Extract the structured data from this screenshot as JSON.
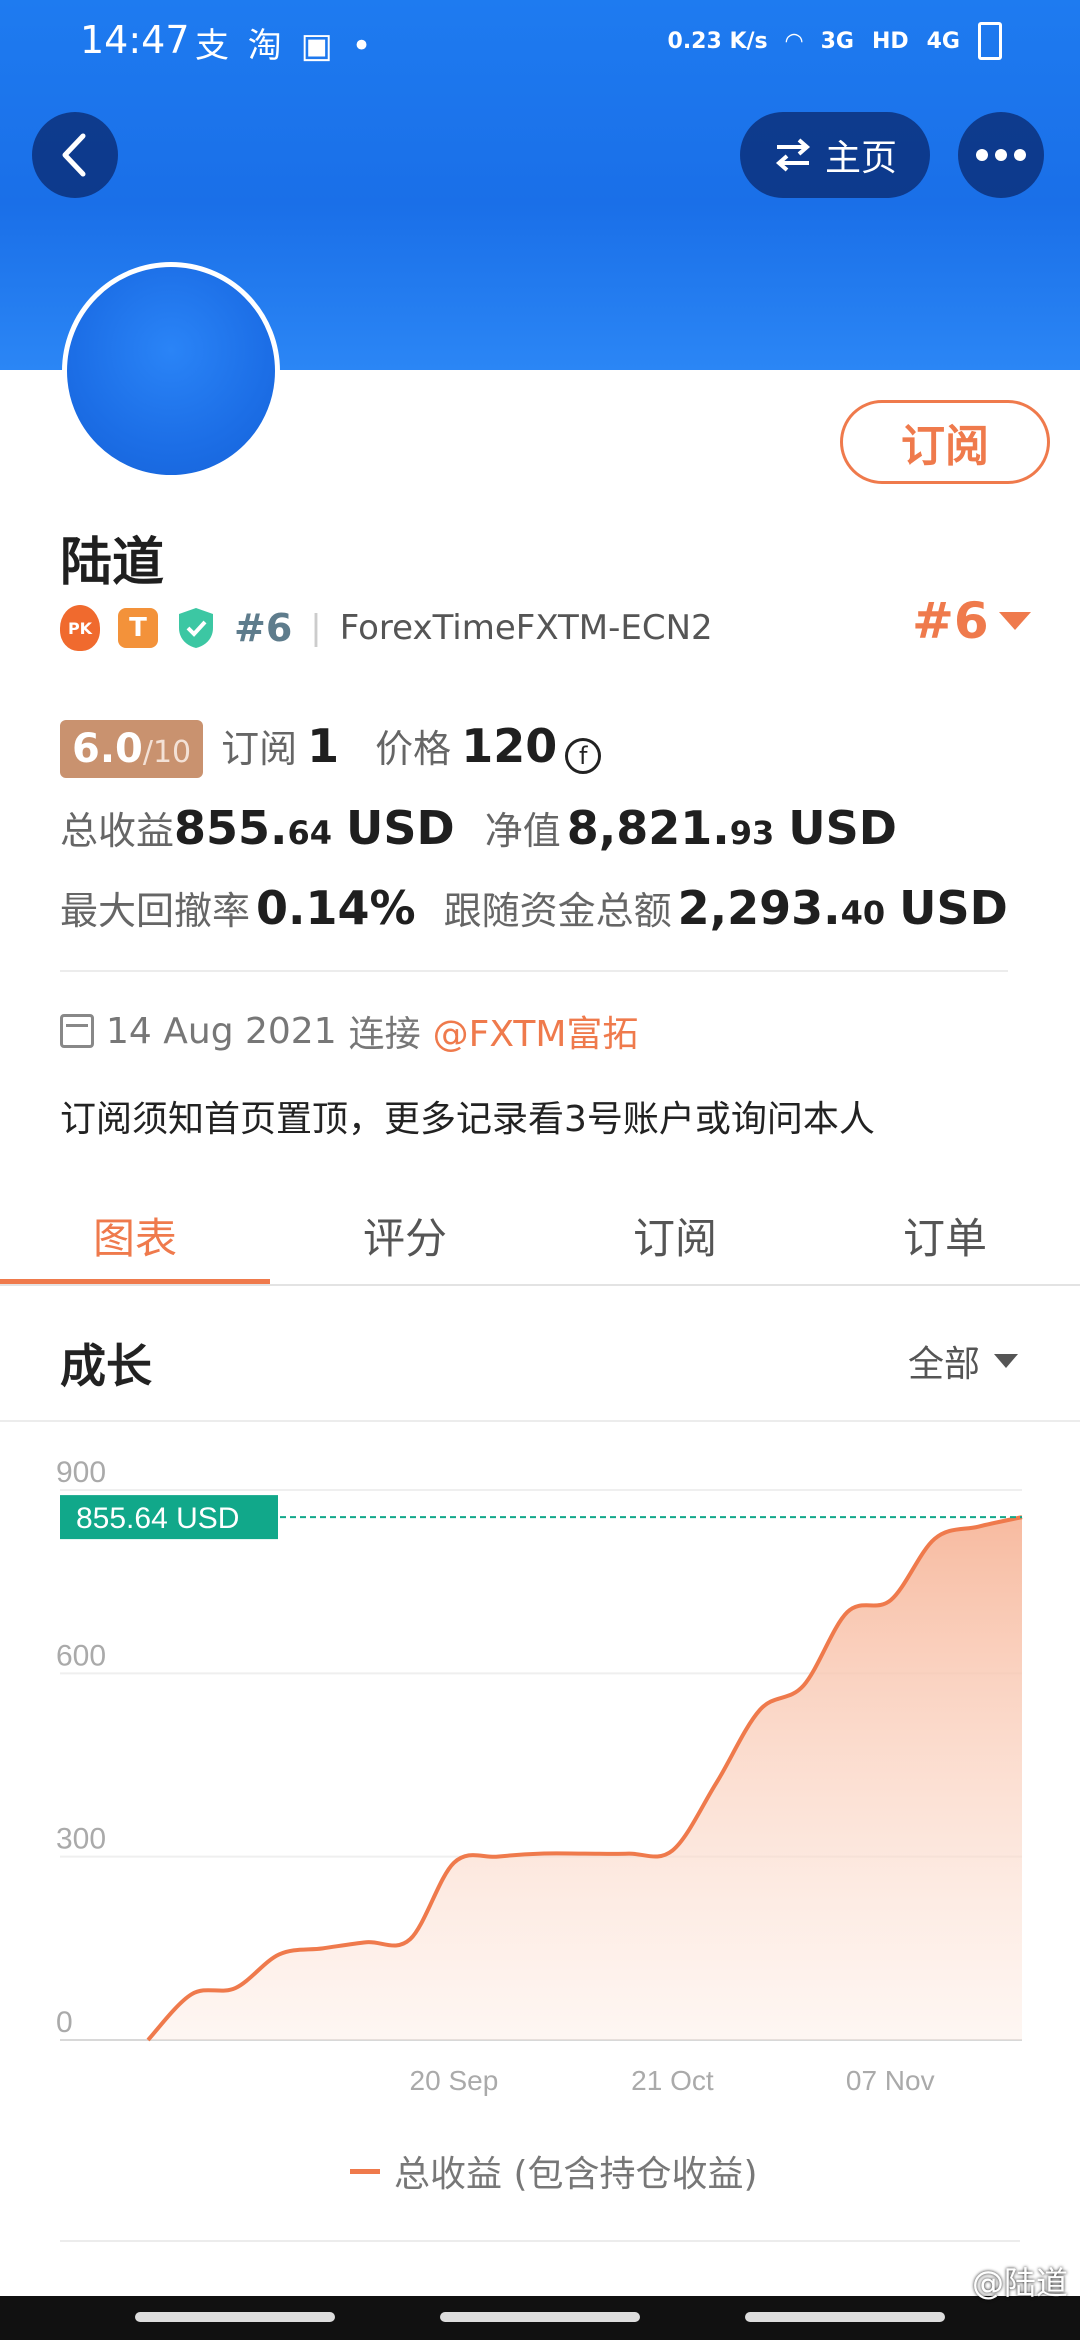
{
  "status_bar": {
    "time": "14:47",
    "apps": "支 淘 ▣ •",
    "speed": "0.23 K/s",
    "net1": "3G",
    "hd": "HD",
    "net2": "4G"
  },
  "header": {
    "home_label": "主页",
    "subscribe_label": "订阅"
  },
  "profile": {
    "name": "陆道",
    "rank_small": "#6",
    "broker": "ForexTimeFXTM-ECN2",
    "rank_big": "#6",
    "badge_pk": "PK",
    "badge_t": "T"
  },
  "stats": {
    "score_main": "6.0",
    "score_max": "/10",
    "subs_label": "订阅",
    "subs_value": "1",
    "price_label": "价格",
    "price_value": "120",
    "coin_symbol": "f",
    "total_profit_label": "总收益",
    "total_profit_int": "855.",
    "total_profit_dec": "64",
    "total_profit_unit": "USD",
    "equity_label": "净值",
    "equity_int": "8,821.",
    "equity_dec": "93",
    "equity_unit": "USD",
    "drawdown_label": "最大回撤率",
    "drawdown_value": "0.14%",
    "follow_label": "跟随资金总额",
    "follow_int": "2,293.",
    "follow_dec": "40",
    "follow_unit": "USD"
  },
  "connection": {
    "date": "14 Aug 2021",
    "text": "连接",
    "link": "@FXTM富拓"
  },
  "notice": "订阅须知首页置顶，更多记录看3号账户或询问本人",
  "tabs": [
    {
      "label": "图表",
      "active": true
    },
    {
      "label": "评分",
      "active": false
    },
    {
      "label": "订阅",
      "active": false
    },
    {
      "label": "订单",
      "active": false
    }
  ],
  "section": {
    "title": "成长",
    "range": "全部"
  },
  "chart_data": {
    "type": "area",
    "current_value_label": "855.64 USD",
    "current_value": 855.64,
    "y_ticks": [
      "0",
      "300",
      "600",
      "900"
    ],
    "ylim": [
      0,
      900
    ],
    "x_tick_labels": [
      "20 Sep",
      "21 Oct",
      "07 Nov"
    ],
    "x": [
      "14 Aug",
      "19 Aug",
      "25 Aug",
      "31 Aug",
      "05 Sep",
      "11 Sep",
      "17 Sep",
      "22 Sep",
      "28 Sep",
      "04 Oct",
      "10 Oct",
      "16 Oct",
      "21 Oct",
      "24 Oct",
      "27 Oct",
      "30 Oct",
      "02 Nov",
      "04 Nov",
      "07 Nov",
      "11 Nov",
      "14 Nov"
    ],
    "values": [
      0,
      75,
      85,
      140,
      150,
      160,
      165,
      290,
      300,
      305,
      305,
      305,
      310,
      420,
      540,
      580,
      700,
      720,
      820,
      840,
      855.64
    ],
    "series": [
      {
        "name": "总收益 (包含持仓收益)",
        "color": "#ef7a4c"
      }
    ]
  },
  "legend_label": "总收益 (包含持仓收益)",
  "watermark": "@陆道",
  "colors": {
    "header_blue": "#1e7bf0",
    "accent": "#ef7a4c",
    "label_bg": "#11a88a",
    "score_bg": "#c9926f"
  }
}
